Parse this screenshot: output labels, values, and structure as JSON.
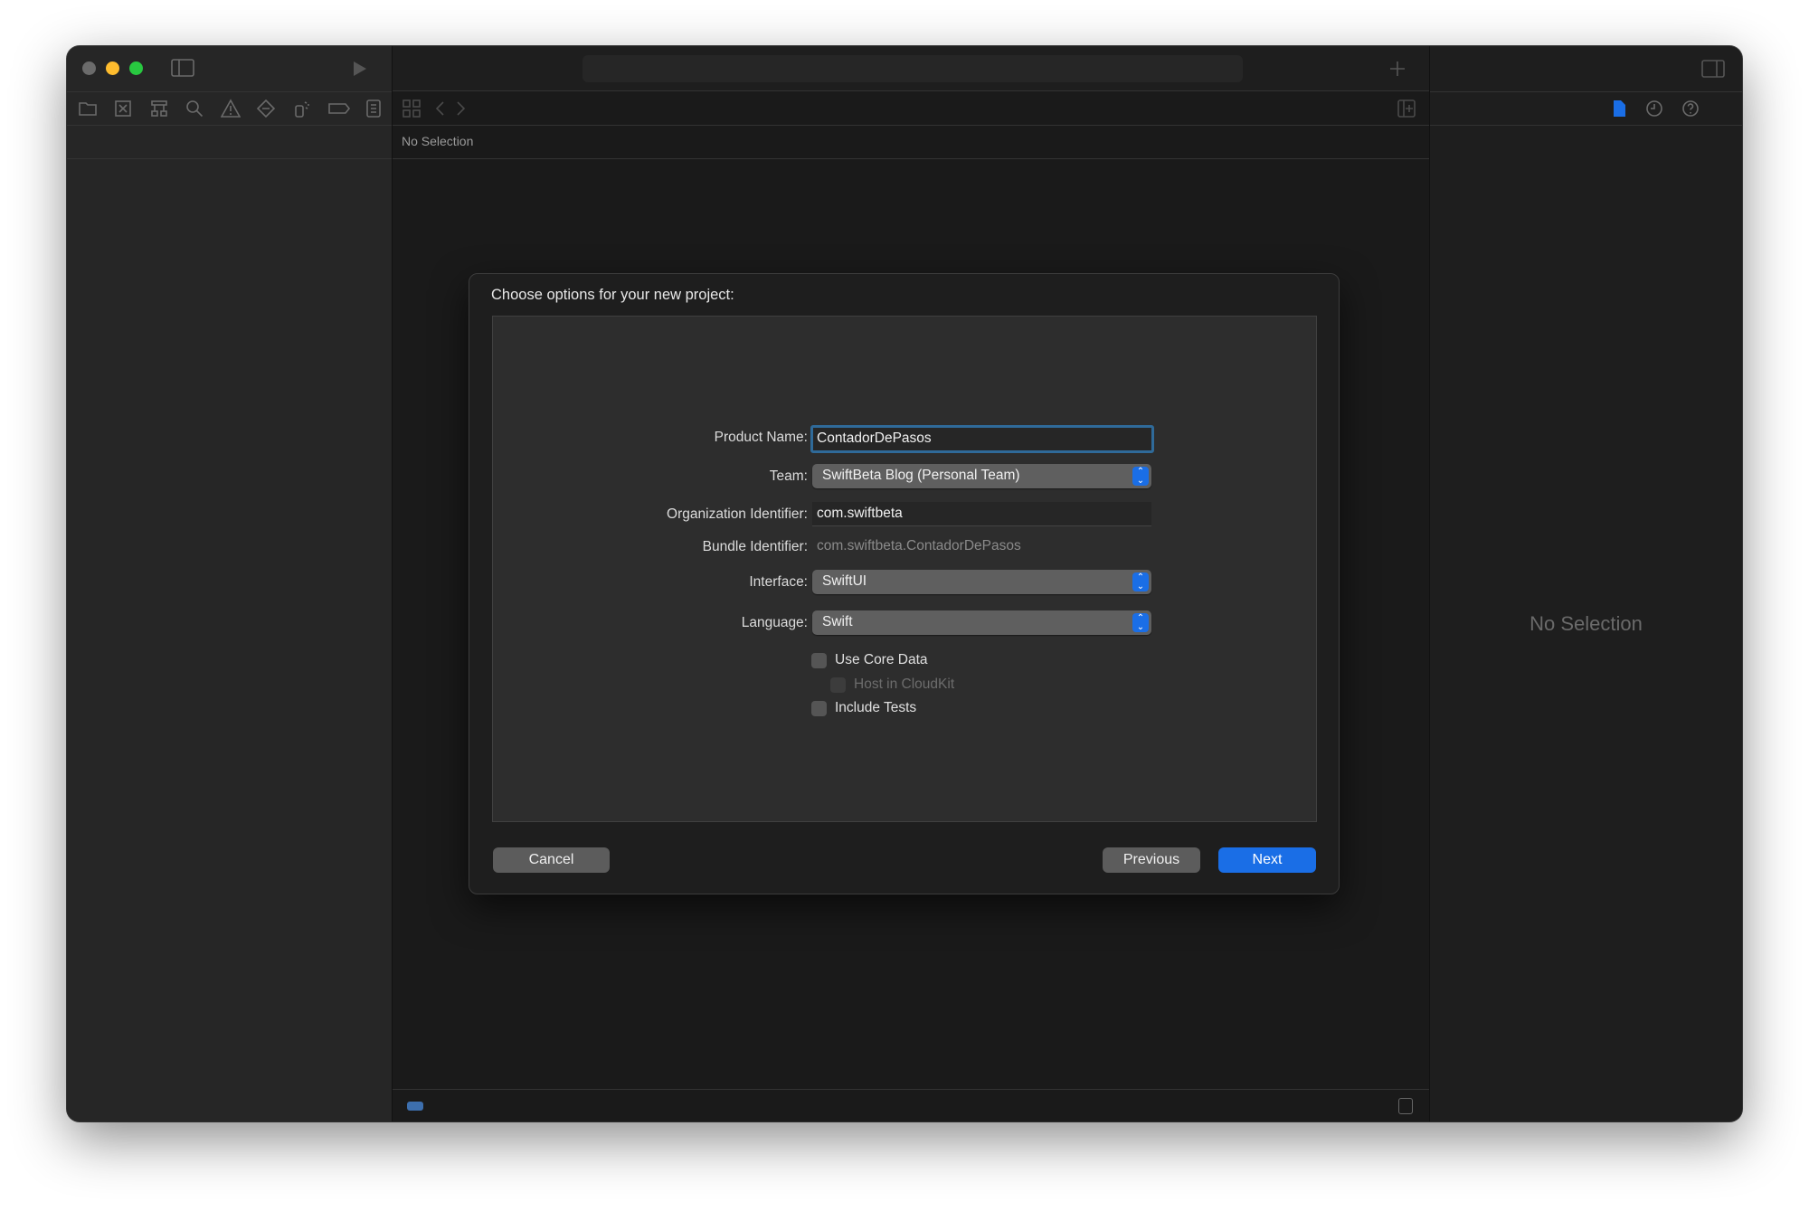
{
  "window": {
    "traffic_lights": {
      "close": "#6b6b6b",
      "minimize": "#febc2e",
      "zoom": "#28c840"
    },
    "navigator_icons": [
      "folder-icon",
      "source-control-icon",
      "hierarchy-icon",
      "search-icon",
      "warning-icon",
      "test-diamond-icon",
      "debug-spray-icon",
      "breakpoint-tag-icon",
      "report-icon"
    ],
    "editor": {
      "jump_bar": "No Selection"
    },
    "inspector": {
      "empty_text": "No Selection",
      "active_tab_color": "#1a6ee6"
    }
  },
  "dialog": {
    "title": "Choose options for your new project:",
    "fields": {
      "product_name": {
        "label": "Product Name:",
        "value": "ContadorDePasos"
      },
      "team": {
        "label": "Team:",
        "value": "SwiftBeta Blog (Personal Team)"
      },
      "org_identifier": {
        "label": "Organization Identifier:",
        "value": "com.swiftbeta"
      },
      "bundle_identifier": {
        "label": "Bundle Identifier:",
        "value": "com.swiftbeta.ContadorDePasos"
      },
      "interface": {
        "label": "Interface:",
        "value": "SwiftUI"
      },
      "language": {
        "label": "Language:",
        "value": "Swift"
      }
    },
    "checkboxes": {
      "use_core_data": {
        "label": "Use Core Data",
        "checked": false
      },
      "host_in_cloudkit": {
        "label": "Host in CloudKit",
        "checked": false,
        "enabled": false
      },
      "include_tests": {
        "label": "Include Tests",
        "checked": false
      }
    },
    "buttons": {
      "cancel": "Cancel",
      "previous": "Previous",
      "next": "Next"
    },
    "accent": "#1a6ee6"
  }
}
